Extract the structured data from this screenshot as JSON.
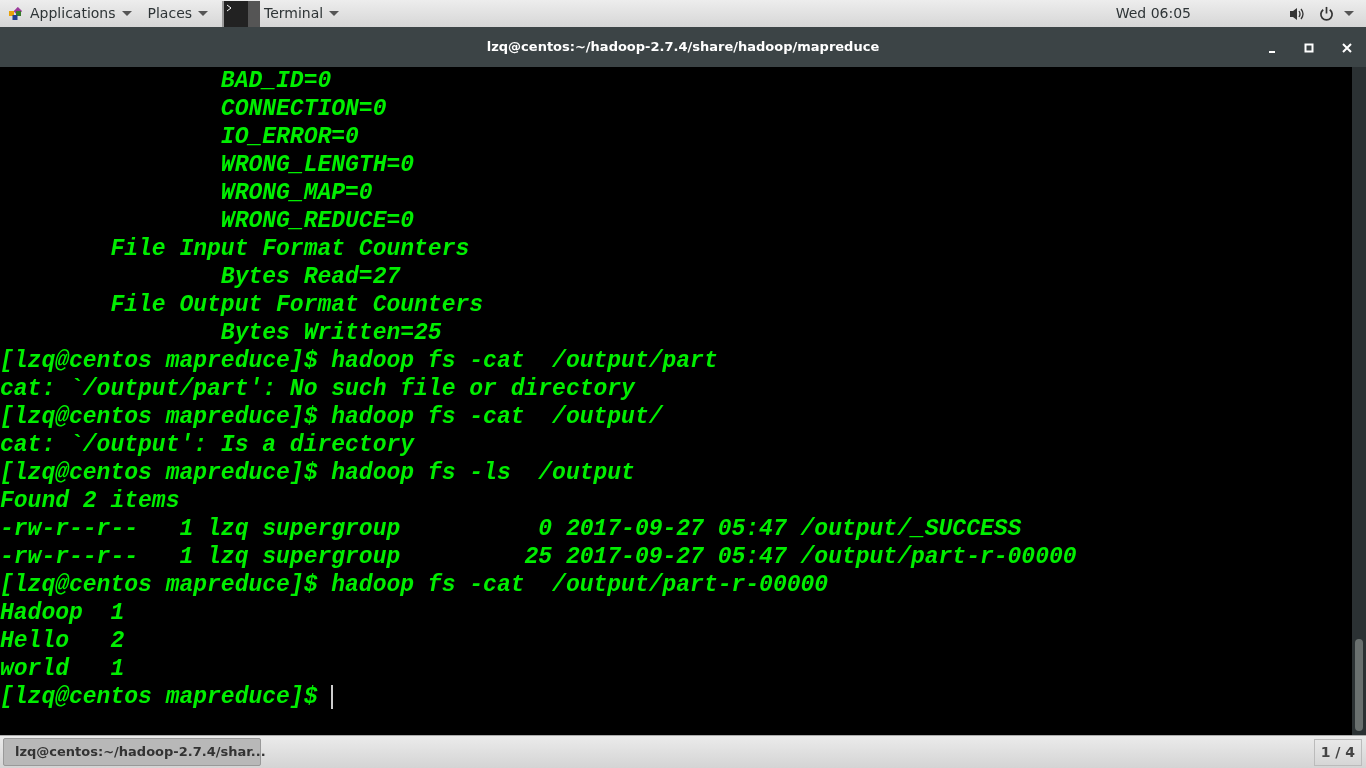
{
  "top_bar": {
    "menus": [
      "Applications",
      "Places"
    ],
    "app_menu": "Terminal",
    "clock": "Wed 06:05"
  },
  "window": {
    "title": "lzq@centos:~/hadoop-2.7.4/share/hadoop/mapreduce"
  },
  "terminal": {
    "cursor": true,
    "lines": [
      "                BAD_ID=0",
      "                CONNECTION=0",
      "                IO_ERROR=0",
      "                WRONG_LENGTH=0",
      "                WRONG_MAP=0",
      "                WRONG_REDUCE=0",
      "        File Input Format Counters ",
      "                Bytes Read=27",
      "        File Output Format Counters ",
      "                Bytes Written=25",
      "[lzq@centos mapreduce]$ hadoop fs -cat  /output/part",
      "cat: `/output/part': No such file or directory",
      "[lzq@centos mapreduce]$ hadoop fs -cat  /output/",
      "cat: `/output': Is a directory",
      "[lzq@centos mapreduce]$ hadoop fs -ls  /output",
      "Found 2 items",
      "-rw-r--r--   1 lzq supergroup          0 2017-09-27 05:47 /output/_SUCCESS",
      "-rw-r--r--   1 lzq supergroup         25 2017-09-27 05:47 /output/part-r-00000",
      "[lzq@centos mapreduce]$ hadoop fs -cat  /output/part-r-00000",
      "Hadoop  1",
      "Hello   2",
      "world   1",
      "[lzq@centos mapreduce]$ "
    ]
  },
  "taskbar": {
    "items": [
      {
        "label": "lzq@centos:~/hadoop-2.7.4/shar...",
        "selected": true
      }
    ],
    "workspace": "1 / 4"
  }
}
